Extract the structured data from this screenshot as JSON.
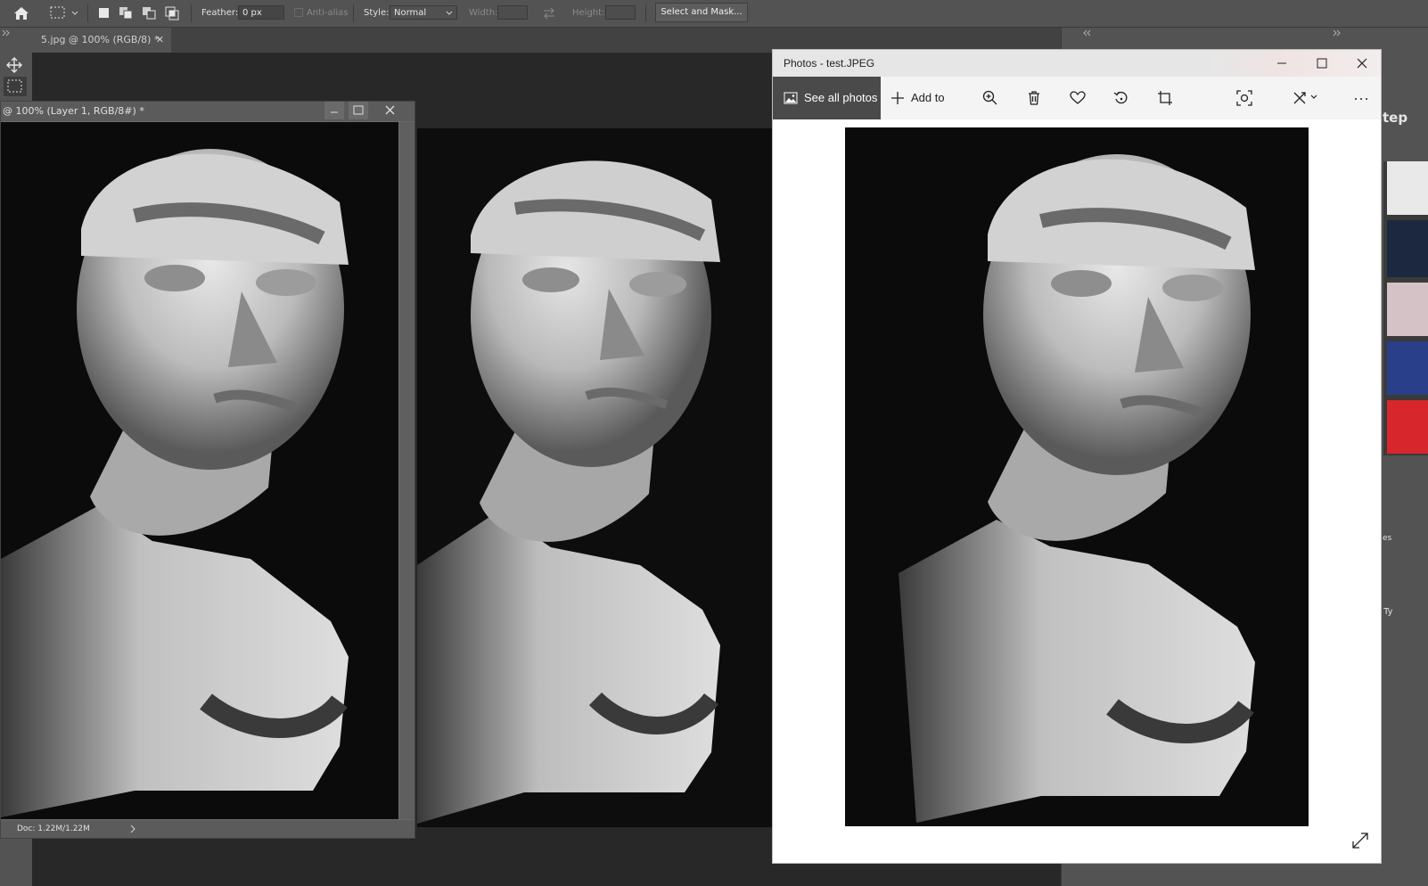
{
  "options_bar": {
    "feather_label": "Feather:",
    "feather_value": "0 px",
    "anti_alias_label": "Anti-alias",
    "style_label": "Style:",
    "style_value": "Normal",
    "width_label": "Width:",
    "height_label": "Height:",
    "select_mask_label": "Select and Mask..."
  },
  "tabs": {
    "active_doc": "5.jpg @ 100% (RGB/8) *"
  },
  "ps_doc_window": {
    "title": "@ 100% (Layer 1, RGB/8#) *",
    "status": "Doc: 1.22M/1.22M"
  },
  "photos": {
    "title": "Photos - test.JPEG",
    "see_all_label": "See all photos",
    "add_to_label": "Add to"
  },
  "right_dock": {
    "partial_1": "tep",
    "partial_2": "es",
    "partial_3": "y Ty"
  },
  "colors": {
    "ps_bg": "#535353",
    "ps_canvas": "#282828",
    "photos_bg": "#ffffff"
  }
}
